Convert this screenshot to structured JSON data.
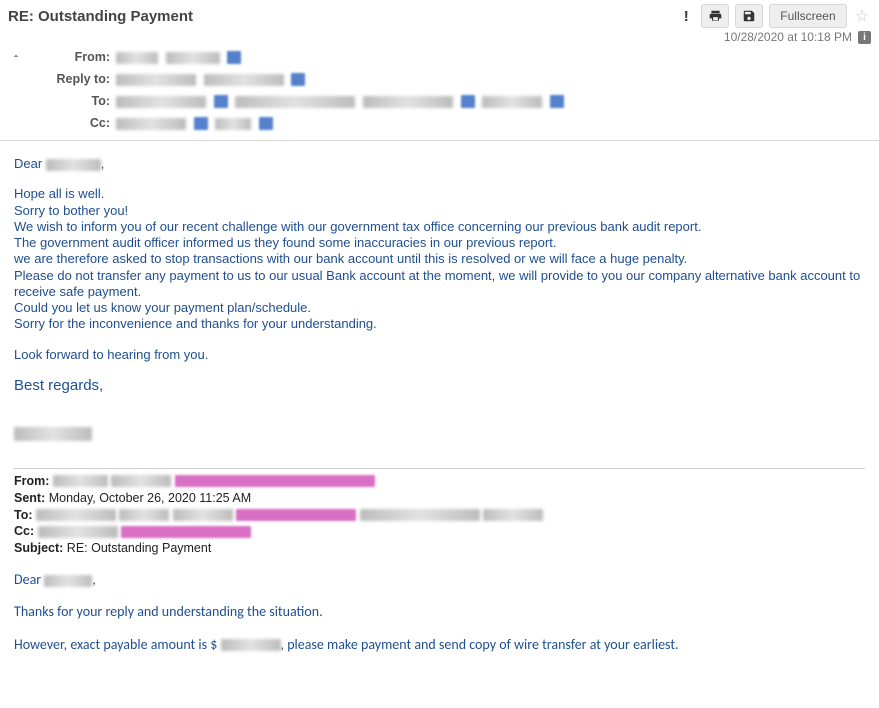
{
  "subject": "RE: Outstanding Payment",
  "timestamp": "10/28/2020 at 10:18 PM",
  "toolbar": {
    "fullscreen_label": "Fullscreen"
  },
  "header_labels": {
    "from": "From:",
    "reply_to": "Reply to:",
    "to": "To:",
    "cc": "Cc:"
  },
  "body": {
    "greeting_prefix": "Dear ",
    "greeting_suffix": ",",
    "l1": "Hope all is well.",
    "l2": "Sorry to bother you!",
    "l3": "We wish to inform you of our recent challenge with our government tax office concerning our previous bank audit report.",
    "l4": "The government audit officer informed us they found some inaccuracies in our previous report.",
    "l5": "we are therefore asked to stop transactions with our bank account until this is resolved or we will face a huge penalty.",
    "l6": "Please do not transfer any payment to us to our usual Bank account at the moment, we will provide to you our company alternative bank account to receive safe payment.",
    "l7": "Could you let us know your payment plan/schedule.",
    "l8": "Sorry for the inconvenience and thanks for your understanding.",
    "l9": "Look forward to hearing from you.",
    "signoff": "Best regards,"
  },
  "quoted": {
    "from_label": "From:",
    "sent_label": "Sent:",
    "sent_value": " Monday, October 26, 2020 11:25 AM",
    "to_label": "To:",
    "cc_label": "Cc:",
    "subject_label": "Subject:",
    "subject_value": " RE: Outstanding Payment",
    "greeting_prefix": "Dear ",
    "greeting_suffix": ",",
    "q1": "Thanks for your reply and understanding the situation.",
    "q2a": "However, exact payable amount is $ ",
    "q2b": ", please make payment and send copy of wire transfer at your earliest."
  }
}
